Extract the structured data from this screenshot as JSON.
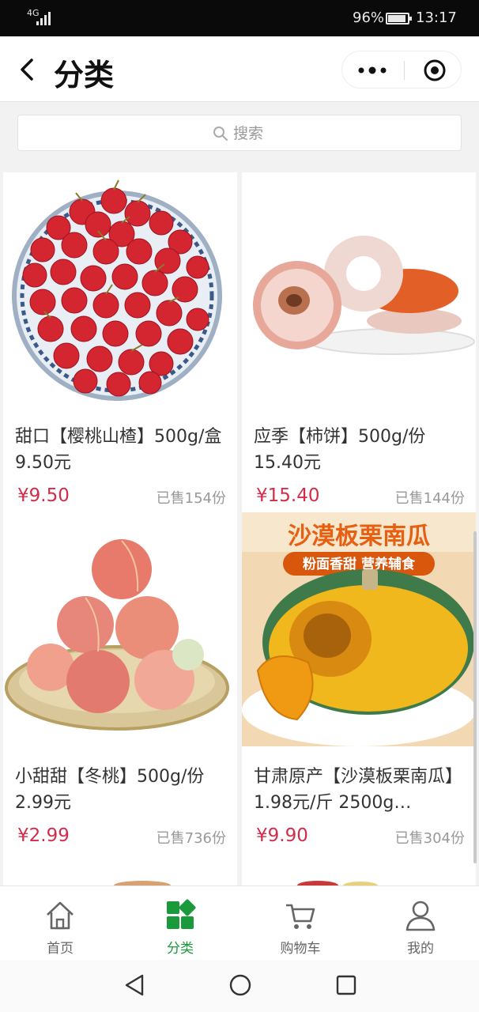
{
  "status_bar": {
    "network": "4G",
    "battery": "96%",
    "time": "13:17"
  },
  "nav": {
    "title": "分类",
    "back_icon": "chevron-left-icon",
    "menu_icon": "more-dots-icon",
    "close_icon": "target-icon"
  },
  "search": {
    "placeholder": "搜索"
  },
  "products": [
    {
      "name": "甜口【樱桃山楂】500g/盒 9.50元",
      "price": "¥9.50",
      "sold": "已售154份"
    },
    {
      "name": "应季【柿饼】500g/份 15.40元",
      "price": "¥15.40",
      "sold": "已售144份"
    },
    {
      "name": "小甜甜【冬桃】500g/份2.99元",
      "price": "¥2.99",
      "sold": "已售736份"
    },
    {
      "name": "甘肃原产【沙漠板栗南瓜】1.98元/斤 2500g…",
      "price": "¥9.90",
      "sold": "已售304份",
      "banner_title": "沙漠板栗南瓜",
      "banner_sub": "粉面香甜 营养辅食"
    }
  ],
  "tabs": [
    {
      "label": "首页",
      "icon": "home-icon"
    },
    {
      "label": "分类",
      "icon": "category-icon"
    },
    {
      "label": "购物车",
      "icon": "cart-icon"
    },
    {
      "label": "我的",
      "icon": "user-icon"
    }
  ],
  "colors": {
    "accent": "#1a9a3a",
    "price": "#d52b4b"
  }
}
